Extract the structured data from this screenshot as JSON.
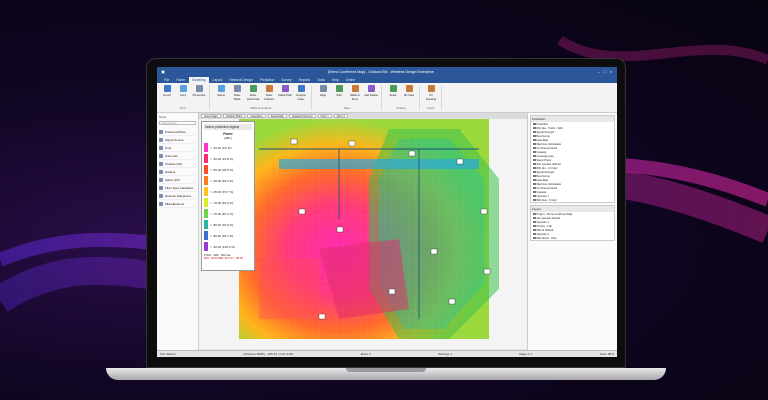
{
  "app": {
    "title": "[Demo Confirmed Map] - Outdoor.Ekt - Wireless Design Enterprise",
    "tabs": [
      "File",
      "Home",
      "Modeling",
      "Layout",
      "Network Design",
      "Prediction",
      "Survey",
      "Reports",
      "Tools",
      "Help",
      "Online"
    ],
    "active_tab": 2
  },
  "ribbon": {
    "groups": [
      {
        "label": "Floor",
        "buttons": [
          "Import",
          "Copy",
          "Properties"
        ]
      },
      {
        "label": "Walls & Surfaces",
        "buttons": [
          "Select",
          "Draw Walls",
          "Draw Horizontal",
          "Draw Inclined",
          "Cable Path",
          "Graphic Index"
        ]
      },
      {
        "label": "Sites",
        "buttons": [
          "Align",
          "Split",
          "Walls to Floor",
          "Add Delete"
        ]
      },
      {
        "label": "Plotting",
        "buttons": [
          "Scale",
          "3D View"
        ]
      },
      {
        "label": "Views",
        "buttons": [
          "Fit Drawing"
        ]
      }
    ]
  },
  "left_panel": {
    "title": "Tools",
    "search_placeholder": "Quick Search",
    "items": [
      "Preferred Plans",
      "Signal Source",
      "Cuts",
      "Antennas",
      "Chassis (Dif)",
      "Haulers",
      "Splice (Dif)",
      "Fiber Spec Hardware",
      "Network Equipment",
      "Miscellaneous"
    ]
  },
  "canvas": {
    "tabs": [
      "Home Page",
      "Outdoor Plans",
      "Integration",
      "Saved Map",
      "Capacity Planning",
      "Floor 1",
      "Floor 2"
    ]
  },
  "legend": {
    "header": "Indoor prediction legend",
    "title": "Power",
    "unit": "(dBm)",
    "rows": [
      {
        "label": "> -40.00 (0.0 %)",
        "color": "#ff33cc"
      },
      {
        "label": "> -50.00 (21.8 %)",
        "color": "#ff2a6d"
      },
      {
        "label": "> -55.00 (49.5 %)",
        "color": "#ff4d2a"
      },
      {
        "label": "> -60.00 (63.6 %)",
        "color": "#ff7a1a"
      },
      {
        "label": "> -65.00 (73.7 %)",
        "color": "#ffc21a"
      },
      {
        "label": "> -70.00 (81.9 %)",
        "color": "#d8ec2a"
      },
      {
        "label": "> -75.00 (87.4 %)",
        "color": "#6fd44a"
      },
      {
        "label": "> -80.00 (91.5 %)",
        "color": "#2ab5a2"
      },
      {
        "label": "> -85.00 (94.1 %)",
        "color": "#3a6fd6"
      },
      {
        "label": "> -90.00 (100.0 %)",
        "color": "#9a3ad6"
      }
    ],
    "footer": "5 GHz - WiFi - 802.11a",
    "footer2": "Max: -30.00 dBm  92.9 % > -85.00"
  },
  "right_panel": {
    "title": "Prediction",
    "tree": [
      {
        "label": "Prediction",
        "on": true
      },
      {
        "label": "802.11a - 5 GHz - WiFi",
        "on": true
      },
      {
        "label": "Signal Strength",
        "on": true
      },
      {
        "label": "Best Server",
        "on": true
      },
      {
        "label": "Data Rate",
        "on": false
      },
      {
        "label": "Maximum Achievable",
        "on": true
      },
      {
        "label": "Co-Channel Interf.",
        "on": false
      },
      {
        "label": "Capacity",
        "on": true
      },
      {
        "label": "Coverage Area",
        "on": false
      },
      {
        "label": "Select Plans",
        "on": true
      },
      {
        "label": "Site operator defined",
        "on": true
      },
      {
        "label": "802.11n - 2.4 GHz",
        "on": true
      },
      {
        "label": "Signal Strength",
        "on": true
      },
      {
        "label": "Best Server",
        "on": false
      },
      {
        "label": "Data Rate",
        "on": true
      },
      {
        "label": "Maximum Achievable",
        "on": true
      },
      {
        "label": "Co-Channel Interf.",
        "on": false
      },
      {
        "label": "Capacity",
        "on": true
      },
      {
        "label": "Operator 1",
        "on": true
      },
      {
        "label": "802.11ac - 5 GHz",
        "on": true
      }
    ],
    "layers_title": "Layers",
    "layers": [
      {
        "label": "Project - Demo Confirmed Map",
        "on": true
      },
      {
        "label": "site operator defined",
        "on": true
      },
      {
        "label": "Operator 1",
        "on": true
      },
      {
        "label": "PA Hex - LTE",
        "on": true
      },
      {
        "label": "802.11 Default",
        "on": false
      },
      {
        "label": "Operator 2",
        "on": true
      },
      {
        "label": "802.11n/ac - Plus",
        "on": true
      }
    ]
  },
  "bottom_bar": {
    "items": [
      "Setting Messages List",
      "Status: Completed",
      "Loading"
    ]
  },
  "statusbar": {
    "left": "Tool: Selector",
    "mid1": "Cell (Every 90000) -- WiFi 5G / 2.4G; 8 APs",
    "mid2": "Errors: 0",
    "mid3": "Warnings: 1",
    "mid4": "Pages 1 / 1",
    "right": "Zoom: 88 %"
  }
}
